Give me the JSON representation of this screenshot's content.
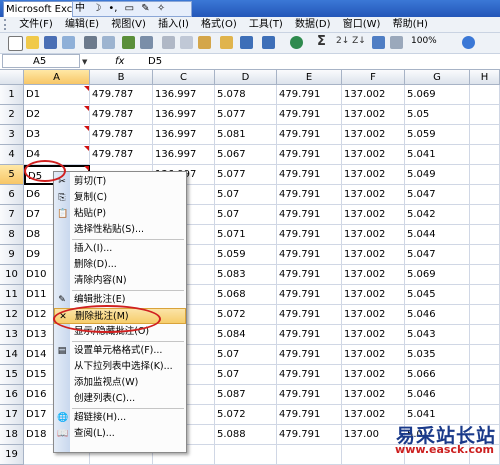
{
  "window": {
    "title": "Microsoft Exc"
  },
  "ime_bar": {
    "items": [
      "中",
      "☽",
      "•,",
      "▭",
      "✎",
      "✧"
    ]
  },
  "menu": {
    "items": [
      "文件(F)",
      "编辑(E)",
      "视图(V)",
      "插入(I)",
      "格式(O)",
      "工具(T)",
      "数据(D)",
      "窗口(W)",
      "帮助(H)"
    ]
  },
  "toolbar": {
    "zoom": "100%",
    "sigma": "Σ",
    "sort": "2↓ Z↓"
  },
  "formula_bar": {
    "cell_ref": "A5",
    "fx": "fx",
    "value": "D5"
  },
  "columns": [
    "A",
    "B",
    "C",
    "D",
    "E",
    "F",
    "G",
    "H"
  ],
  "rows": [
    {
      "n": "1",
      "cells": [
        "D1",
        "479.787",
        "136.997",
        "5.078",
        "479.791",
        "137.002",
        "5.069"
      ]
    },
    {
      "n": "2",
      "cells": [
        "D2",
        "479.787",
        "136.997",
        "5.077",
        "479.791",
        "137.002",
        "5.05"
      ]
    },
    {
      "n": "3",
      "cells": [
        "D3",
        "479.787",
        "136.997",
        "5.081",
        "479.791",
        "137.002",
        "5.059"
      ]
    },
    {
      "n": "4",
      "cells": [
        "D4",
        "479.787",
        "136.997",
        "5.067",
        "479.791",
        "137.002",
        "5.041"
      ]
    },
    {
      "n": "5",
      "cells": [
        "D5",
        "",
        "136.997",
        "5.077",
        "479.791",
        "137.002",
        "5.049"
      ]
    },
    {
      "n": "6",
      "cells": [
        "D6",
        "",
        "",
        "5.07",
        "479.791",
        "137.002",
        "5.047"
      ]
    },
    {
      "n": "7",
      "cells": [
        "D7",
        "",
        "",
        "5.07",
        "479.791",
        "137.002",
        "5.042"
      ]
    },
    {
      "n": "8",
      "cells": [
        "D8",
        "",
        "",
        "5.071",
        "479.791",
        "137.002",
        "5.044"
      ]
    },
    {
      "n": "9",
      "cells": [
        "D9",
        "",
        "",
        "5.059",
        "479.791",
        "137.002",
        "5.047"
      ]
    },
    {
      "n": "10",
      "cells": [
        "D10",
        "",
        "",
        "5.083",
        "479.791",
        "137.002",
        "5.069"
      ]
    },
    {
      "n": "11",
      "cells": [
        "D11",
        "",
        "",
        "5.068",
        "479.791",
        "137.002",
        "5.045"
      ]
    },
    {
      "n": "12",
      "cells": [
        "D12",
        "",
        "",
        "5.072",
        "479.791",
        "137.002",
        "5.046"
      ]
    },
    {
      "n": "13",
      "cells": [
        "D13",
        "",
        "",
        "5.084",
        "479.791",
        "137.002",
        "5.043"
      ]
    },
    {
      "n": "14",
      "cells": [
        "D14",
        "",
        "",
        "5.07",
        "479.791",
        "137.002",
        "5.035"
      ]
    },
    {
      "n": "15",
      "cells": [
        "D15",
        "",
        "",
        "5.07",
        "479.791",
        "137.002",
        "5.066"
      ]
    },
    {
      "n": "16",
      "cells": [
        "D16",
        "",
        "",
        "5.087",
        "479.791",
        "137.002",
        "5.046"
      ]
    },
    {
      "n": "17",
      "cells": [
        "D17",
        "",
        "",
        "5.072",
        "479.791",
        "137.002",
        "5.041"
      ]
    },
    {
      "n": "18",
      "cells": [
        "D18",
        "",
        "",
        "5.088",
        "479.791",
        "137.00",
        "5.0"
      ]
    },
    {
      "n": "19",
      "cells": [
        "",
        "",
        "",
        "",
        "",
        "",
        ""
      ]
    }
  ],
  "context_menu": {
    "items": [
      {
        "label": "剪切(T)",
        "icon": "✂"
      },
      {
        "label": "复制(C)",
        "icon": "⎘"
      },
      {
        "label": "粘贴(P)",
        "icon": "📋"
      },
      {
        "label": "选择性粘贴(S)...",
        "icon": ""
      },
      {
        "label": "插入(I)...",
        "icon": ""
      },
      {
        "label": "删除(D)...",
        "icon": ""
      },
      {
        "label": "清除内容(N)",
        "icon": ""
      },
      {
        "label": "编辑批注(E)",
        "icon": "✎"
      },
      {
        "label": "删除批注(M)",
        "icon": "✕"
      },
      {
        "label": "显示/隐藏批注(O)",
        "icon": ""
      },
      {
        "label": "设置单元格格式(F)...",
        "icon": "▤"
      },
      {
        "label": "从下拉列表中选择(K)...",
        "icon": ""
      },
      {
        "label": "添加监视点(W)",
        "icon": ""
      },
      {
        "label": "创建列表(C)...",
        "icon": ""
      },
      {
        "label": "超链接(H)...",
        "icon": "🌐"
      },
      {
        "label": "查阅(L)...",
        "icon": "📖"
      }
    ],
    "highlighted_index": 8
  },
  "watermark": {
    "text": "易采站长站",
    "url": "www.easck.com"
  },
  "colors": {
    "selection": "#f7c667",
    "annotation": "#d02020",
    "watermark_blue": "#1a3a8a",
    "watermark_red": "#cc2020"
  }
}
